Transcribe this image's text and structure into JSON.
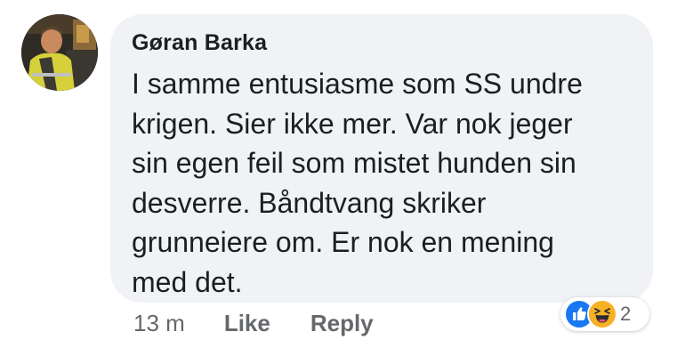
{
  "comment": {
    "author": "Gøran Barka",
    "text_lines": [
      "I samme entusiasme som SS undre",
      "krigen. Sier ikke mer. Var nok jeger",
      "sin egen feil som mistet hunden sin",
      "desverre. Båndtvang skriker",
      "grunneiere om. Er nok en mening",
      "med det."
    ],
    "timestamp": "13 m",
    "actions": {
      "like_label": "Like",
      "reply_label": "Reply"
    }
  },
  "reactions": {
    "icons": [
      "like-icon",
      "haha-icon"
    ],
    "count": "2"
  },
  "colors": {
    "bubble_bg": "#f0f2f5",
    "text": "#1c1e21",
    "secondary_text": "#65676b",
    "like_blue": "#1877f2",
    "haha_yellow": "#f7b125"
  }
}
